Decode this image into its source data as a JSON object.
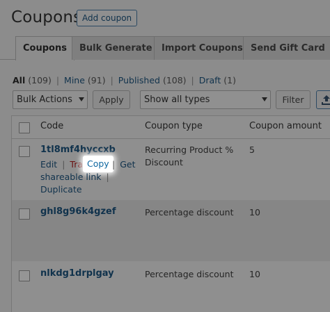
{
  "header": {
    "title": "Coupons",
    "add_button": "Add coupon"
  },
  "tabs": [
    {
      "label": "Coupons",
      "active": true
    },
    {
      "label": "Bulk Generate",
      "active": false
    },
    {
      "label": "Import Coupons",
      "active": false
    },
    {
      "label": "Send Gift Card",
      "active": false
    }
  ],
  "filters": {
    "all": {
      "label": "All",
      "count": "(109)"
    },
    "mine": {
      "label": "Mine",
      "count": "(91)"
    },
    "published": {
      "label": "Published",
      "count": "(108)"
    },
    "draft": {
      "label": "Draft",
      "count": "(1)"
    },
    "separator": "|"
  },
  "toolbar": {
    "bulk_actions": "Bulk Actions",
    "apply": "Apply",
    "type_filter": "Show all types",
    "filter": "Filter"
  },
  "table": {
    "columns": [
      "Code",
      "Coupon type",
      "Coupon amount"
    ],
    "rows": [
      {
        "code": "1tl8mf4hyccxb",
        "type_line1": "Recurring Product %",
        "type_line2": "Discount",
        "amount": "5"
      },
      {
        "code": "ghl8g96k4gzef",
        "type_line1": "Percentage discount",
        "amount": "10"
      },
      {
        "code": "nlkdg1drplgay",
        "type_line1": "Percentage discount",
        "amount": "10"
      }
    ],
    "row_actions": {
      "edit": "Edit",
      "trash": "Trash",
      "copy": "Copy",
      "get_link_1": "Get",
      "get_link_2": "shareable link",
      "duplicate": "Duplicate",
      "separator": "|"
    }
  },
  "colors": {
    "link": "#10324c",
    "trash": "#6a0f0f",
    "highlight_bg": "#ffffff",
    "highlight_text": "#0e67a0",
    "overlay_bg": "#8c8c8c"
  }
}
